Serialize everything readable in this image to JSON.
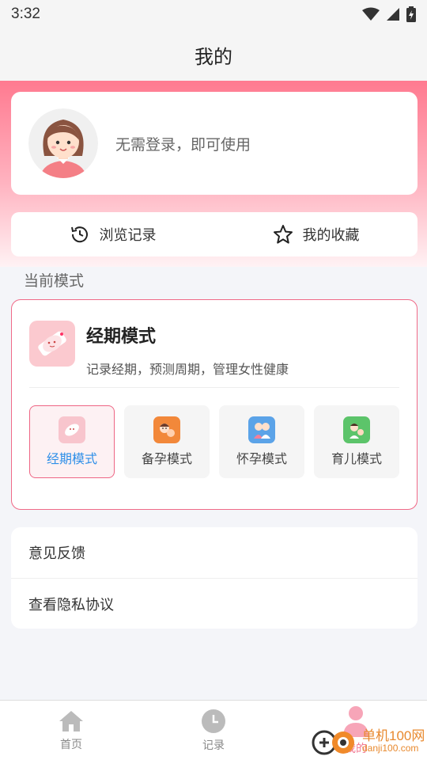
{
  "status_bar": {
    "time": "3:32"
  },
  "header": {
    "title": "我的"
  },
  "profile": {
    "login_text": "无需登录，即可使用"
  },
  "quick_actions": {
    "history_label": "浏览记录",
    "favorites_label": "我的收藏"
  },
  "current_mode": {
    "section_label": "当前模式",
    "title": "经期模式",
    "description": "记录经期，预测周期，管理女性健康",
    "options": [
      {
        "label": "经期模式",
        "active": true,
        "color": "#f8b8c4"
      },
      {
        "label": "备孕模式",
        "active": false,
        "color": "#f2883a"
      },
      {
        "label": "怀孕模式",
        "active": false,
        "color": "#5ba3e8"
      },
      {
        "label": "育儿模式",
        "active": false,
        "color": "#5cc46a"
      }
    ]
  },
  "settings_list": {
    "feedback_label": "意见反馈",
    "privacy_label": "查看隐私协议"
  },
  "tab_bar": {
    "home_label": "首页",
    "record_label": "记录",
    "mine_label": "我的"
  },
  "watermark": {
    "brand": "单机100网",
    "url": "danji100.com"
  },
  "colors": {
    "accent_pink": "#f06a88",
    "active_blue": "#2e8fe8",
    "header_bg": "#f5f5f5"
  }
}
